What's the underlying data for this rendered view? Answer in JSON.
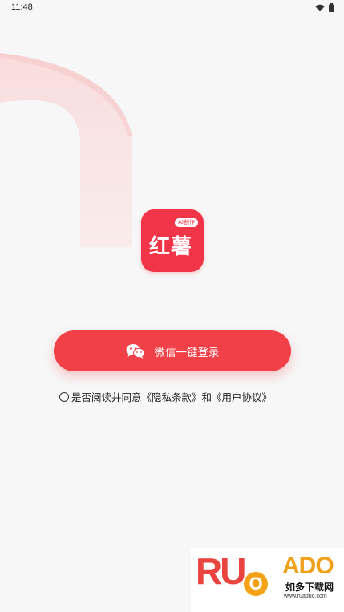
{
  "status_bar": {
    "time": "11:48"
  },
  "logo": {
    "name": "红薯",
    "badge": "AI创作"
  },
  "login_button": {
    "label": "微信一键登录"
  },
  "agreement": {
    "text": "是否阅读并同意《隐私条款》和《用户协议》"
  },
  "watermark": {
    "brand_left": "RU",
    "brand_o": "O",
    "brand_right": "ADO",
    "name": "如多下载网",
    "url": "www.ruaduo.com"
  },
  "colors": {
    "accent": "#f24049",
    "logo_bg": "#f23448",
    "decor": "#f9d3d3",
    "background": "#f7f7f7"
  },
  "icons": [
    "wifi-icon",
    "battery-icon",
    "wechat-icon",
    "radio-icon"
  ]
}
